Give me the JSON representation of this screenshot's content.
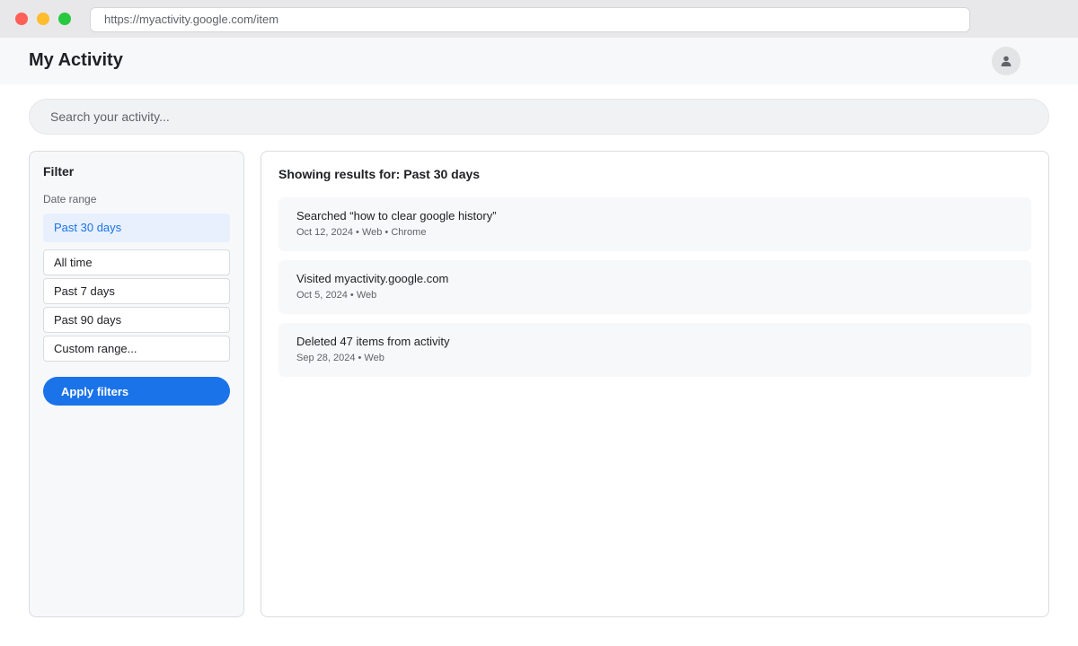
{
  "browser": {
    "url": "https://myactivity.google.com/item"
  },
  "header": {
    "title": "My Activity",
    "avatar_icon": "person-icon"
  },
  "search": {
    "placeholder": "Search your activity...",
    "value": ""
  },
  "filter": {
    "title": "Filter",
    "subtitle": "Date range",
    "selected": "Past 30 days",
    "options": [
      "All time",
      "Past 7 days",
      "Past 90 days",
      "Custom range..."
    ],
    "apply_label": "Apply filters"
  },
  "results": {
    "heading": "Showing results for: Past 30 days",
    "items": [
      {
        "title": "Searched “how to clear google history”",
        "meta": "Oct 12, 2024 • Web • Chrome"
      },
      {
        "title": "Visited myactivity.google.com",
        "meta": "Oct 5, 2024 • Web"
      },
      {
        "title": "Deleted 47 items from activity",
        "meta": "Sep 28, 2024 • Web"
      }
    ]
  },
  "colors": {
    "accent": "#1a73e8",
    "selected_bg": "#e8f0fe",
    "panel_bg": "#f7f8fa"
  }
}
